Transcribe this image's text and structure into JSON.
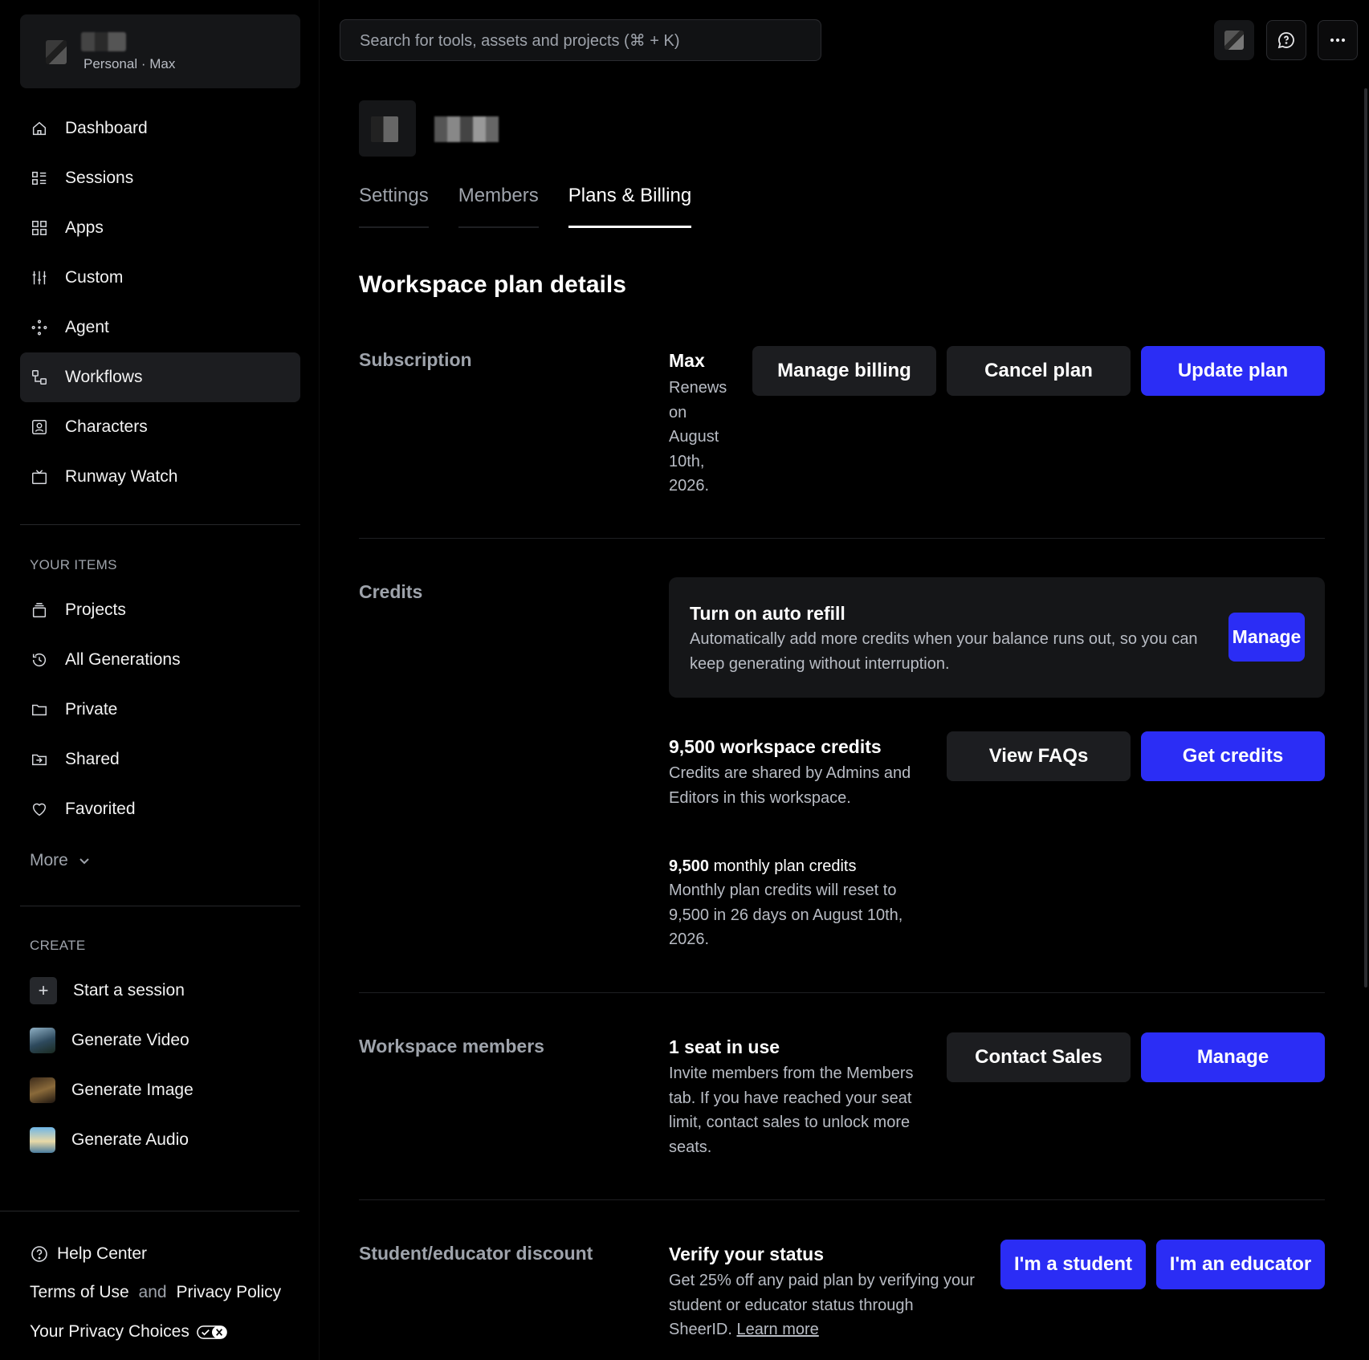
{
  "workspace": {
    "subtitle": "Personal · Max"
  },
  "search": {
    "placeholder": "Search for tools, assets and projects (⌘ + K)"
  },
  "sidebar": {
    "items": [
      {
        "label": "Dashboard",
        "icon": "home-icon"
      },
      {
        "label": "Sessions",
        "icon": "sessions-icon"
      },
      {
        "label": "Apps",
        "icon": "apps-icon"
      },
      {
        "label": "Custom",
        "icon": "sliders-icon"
      },
      {
        "label": "Agent",
        "icon": "agent-icon"
      },
      {
        "label": "Workflows",
        "icon": "workflow-icon",
        "active": true
      },
      {
        "label": "Characters",
        "icon": "character-icon"
      },
      {
        "label": "Runway Watch",
        "icon": "tv-icon"
      }
    ],
    "your_items_label": "YOUR ITEMS",
    "your_items": [
      {
        "label": "Projects",
        "icon": "projects-icon"
      },
      {
        "label": "All Generations",
        "icon": "history-icon"
      },
      {
        "label": "Private",
        "icon": "folder-icon"
      },
      {
        "label": "Shared",
        "icon": "shared-icon"
      },
      {
        "label": "Favorited",
        "icon": "heart-icon"
      }
    ],
    "more_label": "More",
    "create_label": "CREATE",
    "create_items": [
      {
        "label": "Start a session"
      },
      {
        "label": "Generate Video"
      },
      {
        "label": "Generate Image"
      },
      {
        "label": "Generate Audio"
      }
    ],
    "help_center": "Help Center",
    "terms": "Terms of Use",
    "and": "and",
    "privacy": "Privacy Policy",
    "privacy_choices": "Your Privacy Choices"
  },
  "tabs": [
    {
      "label": "Settings"
    },
    {
      "label": "Members"
    },
    {
      "label": "Plans & Billing",
      "active": true
    }
  ],
  "main": {
    "title": "Workspace plan details",
    "subscription": {
      "label": "Subscription",
      "plan": "Max",
      "renew_lines": [
        "Renews",
        "on",
        "August",
        "10th,",
        "2026."
      ],
      "manage_billing": "Manage billing",
      "cancel_plan": "Cancel plan",
      "update_plan": "Update plan"
    },
    "credits": {
      "label": "Credits",
      "refill_title": "Turn on auto refill",
      "refill_desc": "Automatically add more credits when your balance runs out, so you can keep generating without interruption.",
      "refill_button": "Manage",
      "workspace_credits_title": "9,500 workspace credits",
      "workspace_credits_desc": "Credits are shared by Admins and Editors in this workspace.",
      "view_faqs": "View FAQs",
      "get_credits": "Get credits",
      "monthly_count": "9,500",
      "monthly_suffix": " monthly plan credits",
      "monthly_desc": "Monthly plan credits will reset to 9,500 in 26 days on August 10th, 2026."
    },
    "members": {
      "label": "Workspace members",
      "title": "1 seat in use",
      "desc": "Invite members from the Members tab. If you have reached your seat limit, contact sales to unlock more seats.",
      "contact_sales": "Contact Sales",
      "manage": "Manage"
    },
    "discount": {
      "label": "Student/educator discount",
      "title": "Verify your status",
      "desc": "Get 25% off any paid plan by verifying your student or educator status through SheerID. ",
      "learn_more": "Learn more",
      "student": "I'm a student",
      "educator": "I'm an educator"
    }
  },
  "colors": {
    "accent": "#2b2df5",
    "card": "#151618",
    "muted": "#9ea3ab"
  }
}
